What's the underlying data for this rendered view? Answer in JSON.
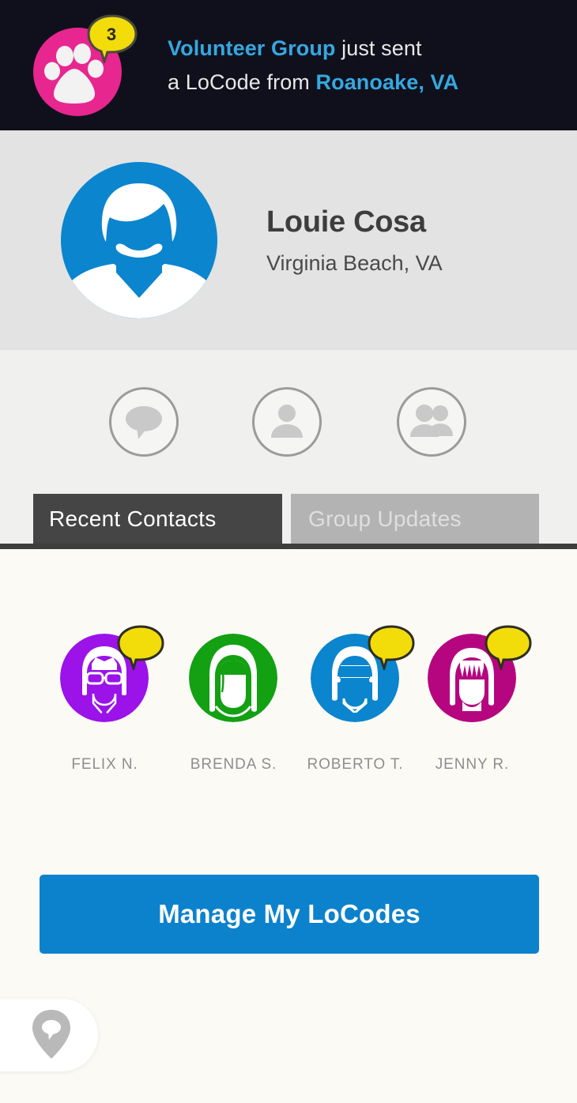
{
  "banner": {
    "badge_count": "3",
    "icon": "paw-print-icon",
    "highlight_color": "#35a8e0",
    "background_color": "#10101c",
    "line1_prefix": "Volunteer Group",
    "line1_suffix": " just sent",
    "line2_prefix": "a LoCode from ",
    "line2_suffix": "Roanoake, VA"
  },
  "profile": {
    "name": "Louie Cosa",
    "location": "Virginia Beach, VA",
    "avatar_color": "#0b85ce"
  },
  "actions": [
    {
      "name": "messages",
      "icon": "chat-bubble-icon"
    },
    {
      "name": "profile",
      "icon": "person-icon"
    },
    {
      "name": "groups",
      "icon": "people-group-icon"
    }
  ],
  "tabs": [
    {
      "label": "Recent Contacts",
      "active": true
    },
    {
      "label": "Group Updates",
      "active": false
    }
  ],
  "contacts": [
    {
      "name": "FELIX N.",
      "color": "#9b13e8",
      "has_badge": true
    },
    {
      "name": "BRENDA S.",
      "color": "#13a013",
      "has_badge": false
    },
    {
      "name": "ROBERTO T.",
      "color": "#0b85ce",
      "has_badge": true
    },
    {
      "name": "JENNY R.",
      "color": "#b5067f",
      "has_badge": true
    }
  ],
  "cta": {
    "label": "Manage My LoCodes",
    "color": "#0c82cc"
  },
  "fab": {
    "icon": "map-pin-chat-icon"
  }
}
